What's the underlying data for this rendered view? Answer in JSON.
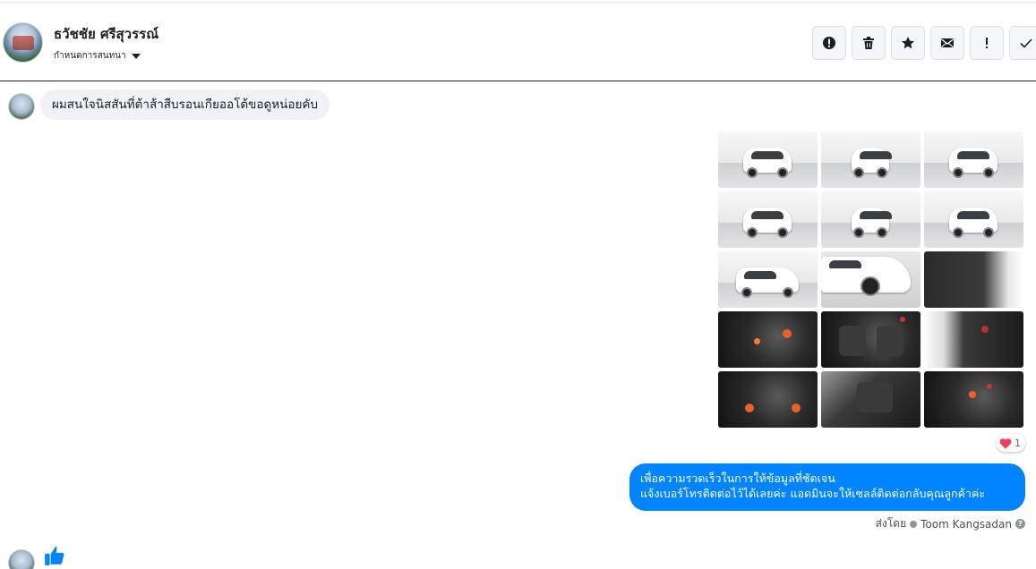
{
  "header": {
    "contact_name": "ธวัชชัย ศรีสุวรรณ์",
    "subtitle": "กำหนดการสนทนา",
    "actions": [
      "alert-icon",
      "trash-icon",
      "star-icon",
      "envelope-icon",
      "exclamation-icon",
      "check-icon"
    ]
  },
  "messages": {
    "incoming_text": "ผมสนใจนิสสันที่ต้าส้าสืบรอนเกียออโต้ขอดูหน่อยคับ",
    "photo_grid": {
      "count": 15,
      "columns": 3,
      "reaction_count": "1"
    },
    "outgoing_line1": "เพื่อความรวดเร็วในการให้ข้อมูลที่ชัดเจน",
    "outgoing_line2": "แจ้งเบอร์โทรติดต่อไว้ได้เลยค่ะ แอดมินจะให้เซลล์ติดต่อกลับคุณลูกค้าค่ะ",
    "sent_by_prefix": "ส่งโดย",
    "sent_by_name": "Toom Kangsadan"
  },
  "colors": {
    "messenger_blue": "#0084ff",
    "incoming_bubble": "#f0f2f5",
    "like_blue": "#0084ff",
    "heart_red": "#f33e58"
  }
}
